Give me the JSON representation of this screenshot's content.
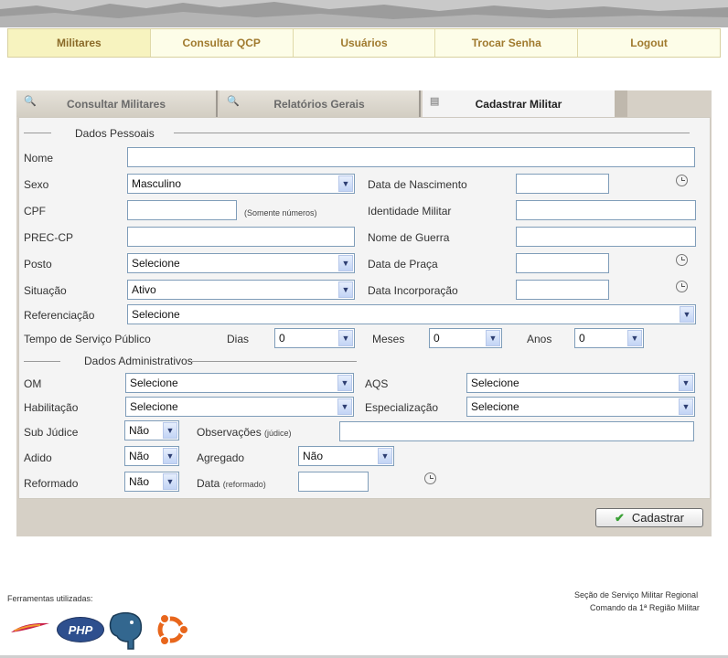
{
  "nav": {
    "items": [
      "Militares",
      "Consultar QCP",
      "Usuários",
      "Trocar Senha",
      "Logout"
    ],
    "active": "Militares"
  },
  "tabs": {
    "consultar": "Consultar Militares",
    "relatorios": "Relatórios Gerais",
    "cadastrar": "Cadastrar Militar"
  },
  "form": {
    "section_pessoais": "Dados Pessoais",
    "section_administrativos": "Dados Administrativos",
    "nome": "Nome",
    "sexo": "Sexo",
    "sexo_value": "Masculino",
    "data_nascimento": "Data de Nascimento",
    "cpf": "CPF",
    "cpf_hint": "(Somente números)",
    "identidade": "Identidade Militar",
    "prec_cp": "PREC-CP",
    "nome_guerra": "Nome de Guerra",
    "posto": "Posto",
    "posto_value": "Selecione",
    "data_praca": "Data de Praça",
    "situacao": "Situação",
    "situacao_value": "Ativo",
    "data_incorporacao": "Data Incorporação",
    "referenciacao": "Referenciação",
    "referenciacao_value": "Selecione",
    "tempo_servico": "Tempo de Serviço Público",
    "dias": "Dias",
    "dias_value": "0",
    "meses": "Meses",
    "meses_value": "0",
    "anos": "Anos",
    "anos_value": "0",
    "om": "OM",
    "om_value": "Selecione",
    "aqs": "AQS",
    "aqs_value": "Selecione",
    "habilitacao": "Habilitação",
    "habilitacao_value": "Selecione",
    "especializacao": "Especialização",
    "especializacao_value": "Selecione",
    "sub_judice": "Sub Júdice",
    "sub_judice_value": "Não",
    "observacoes": "Observações",
    "observacoes_hint": "(júdice)",
    "adido": "Adido",
    "adido_value": "Não",
    "agregado": "Agregado",
    "agregado_value": "Não",
    "reformado": "Reformado",
    "reformado_value": "Não",
    "data": "Data",
    "data_hint": "(reformado)",
    "submit": "Cadastrar"
  },
  "footer": {
    "tools_label": "Ferramentas utilizadas:",
    "org_line1": "Seção de Serviço Militar Regional",
    "org_line2": "Comando da 1ª Região Militar",
    "logos": {
      "php": "PHP"
    }
  }
}
